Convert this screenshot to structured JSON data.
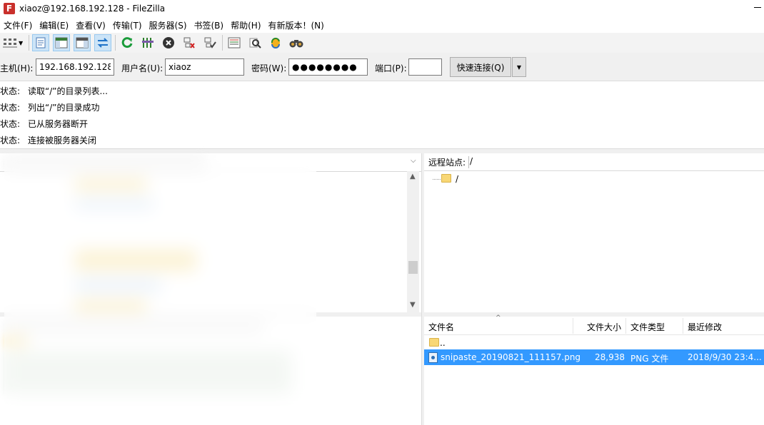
{
  "window": {
    "title": "xiaoz@192.168.192.128 - FileZilla",
    "app_icon": "filezilla-icon"
  },
  "menu": [
    "文件(F)",
    "编辑(E)",
    "查看(V)",
    "传输(T)",
    "服务器(S)",
    "书签(B)",
    "帮助(H)",
    "有新版本！(N)"
  ],
  "toolbar": {
    "icons": [
      "site-manager-icon",
      "toggle-log-icon",
      "toggle-local-tree-icon",
      "toggle-remote-tree-icon",
      "toggle-queue-icon",
      "refresh-icon",
      "process-queue-icon",
      "cancel-icon",
      "disconnect-icon",
      "reconnect-icon",
      "filter-icon",
      "search-icon",
      "compare-icon",
      "find-files-icon"
    ]
  },
  "quickconnect": {
    "host_label": "主机(H):",
    "host_value": "192.168.192.128",
    "user_label": "用户名(U):",
    "user_value": "xiaoz",
    "pass_label": "密码(W):",
    "pass_value": "●●●●●●●●",
    "port_label": "端口(P):",
    "port_value": "",
    "connect_label": "快速连接(Q)",
    "dropdown_icon": "chevron-down-icon"
  },
  "log": [
    {
      "key": "状态:",
      "msg": "读取“/”的目录列表..."
    },
    {
      "key": "状态:",
      "msg": "列出“/”的目录成功"
    },
    {
      "key": "状态:",
      "msg": "已从服务器断开"
    },
    {
      "key": "状态:",
      "msg": "连接被服务器关闭"
    }
  ],
  "remote": {
    "site_label": "远程站点:",
    "site_path": "/",
    "tree_root": "/",
    "columns": [
      "文件名",
      "文件大小",
      "文件类型",
      "最近修改"
    ],
    "files": [
      {
        "name": "..",
        "size": "",
        "type": "",
        "modified": ""
      },
      {
        "name": "snipaste_20190821_111157.png",
        "size": "28,938",
        "type": "PNG 文件",
        "modified": "2018/9/30 23:4..."
      }
    ]
  },
  "colors": {
    "selection": "#3399ff",
    "toolbar_bg": "#f3f3f3",
    "folder": "#f8d775"
  }
}
